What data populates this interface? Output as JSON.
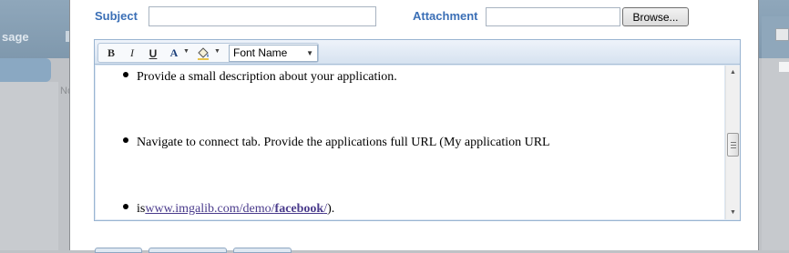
{
  "background": {
    "tab_text": "sage",
    "panel_text": "No"
  },
  "form": {
    "subject_label": "Subject",
    "subject_value": "",
    "attachment_label": "Attachment",
    "attachment_value": "",
    "browse_label": "Browse..."
  },
  "toolbar": {
    "bold": "B",
    "italic": "I",
    "underline": "U",
    "font_color": "A",
    "highlight_icon": "paint-bucket-icon",
    "font_name": "Font Name"
  },
  "content": {
    "line1": "Provide a small description about your application.",
    "line2": "Navigate to connect tab. Provide the applications full URL (My application URL",
    "line3_prefix": "is",
    "line3_link_a": "www.imgalib.com/demo/",
    "line3_link_b": "facebook",
    "line3_link_c": "/",
    "line3_suffix": ")."
  },
  "colors": {
    "label": "#3b6fb6",
    "link": "#4a3b8c",
    "toolbar_bg": "#dde7f3"
  }
}
